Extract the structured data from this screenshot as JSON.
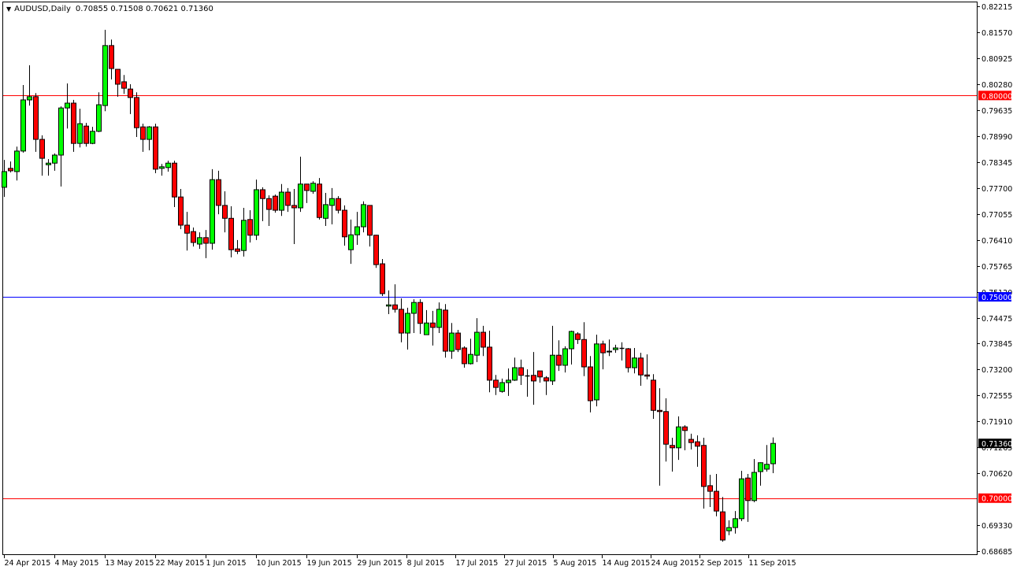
{
  "header": {
    "symbol": "AUDUSD,Daily",
    "ohlc": "0.70855 0.71508 0.70621 0.71360"
  },
  "chart_data": {
    "type": "candlestick",
    "title": "AUDUSD,Daily",
    "ylim": [
      0.68685,
      0.82215
    ],
    "colors": {
      "up": "#00ff00",
      "down": "#ff0000",
      "outline": "#000000"
    },
    "price_ticks": [
      "0.82215",
      "0.81570",
      "0.80925",
      "0.80280",
      "0.79635",
      "0.78990",
      "0.78345",
      "0.77700",
      "0.77055",
      "0.76410",
      "0.75765",
      "0.75120",
      "0.74475",
      "0.73845",
      "0.73200",
      "0.72555",
      "0.71910",
      "0.71265",
      "0.70620",
      "0.69330",
      "0.68685"
    ],
    "date_ticks": [
      "24 Apr 2015",
      "4 May 2015",
      "13 May 2015",
      "22 May 2015",
      "1 Jun 2015",
      "10 Jun 2015",
      "19 Jun 2015",
      "29 Jun 2015",
      "8 Jul 2015",
      "17 Jul 2015",
      "27 Jul 2015",
      "5 Aug 2015",
      "14 Aug 2015",
      "24 Aug 2015",
      "2 Sep 2015",
      "11 Sep 2015"
    ],
    "levels": [
      {
        "price": 0.8,
        "label": "0.80000",
        "color": "#ff0000",
        "line_color": "#ff0000"
      },
      {
        "price": 0.75,
        "label": "0.75000",
        "color": "#0000ff",
        "line_color": "#0000ff"
      },
      {
        "price": 0.7,
        "label": "0.70000",
        "color": "#ff0000",
        "line_color": "#ff0000"
      }
    ],
    "current_price": {
      "price": 0.7136,
      "label": "0.71360",
      "color": "#000000"
    },
    "candles_ohlc": [
      [
        0.7772,
        0.784,
        0.7748,
        0.7811
      ],
      [
        0.7819,
        0.7836,
        0.7809,
        0.7813
      ],
      [
        0.7811,
        0.7873,
        0.7789,
        0.7862
      ],
      [
        0.7862,
        0.8026,
        0.7858,
        0.7989
      ],
      [
        0.7989,
        0.8075,
        0.7975,
        0.7997
      ],
      [
        0.7997,
        0.8006,
        0.786,
        0.7891
      ],
      [
        0.7891,
        0.7901,
        0.7801,
        0.7844
      ],
      [
        0.7828,
        0.7842,
        0.7801,
        0.7832
      ],
      [
        0.7832,
        0.7856,
        0.7813,
        0.7852
      ],
      [
        0.7852,
        0.7973,
        0.7774,
        0.7969
      ],
      [
        0.7969,
        0.803,
        0.7918,
        0.7981
      ],
      [
        0.7981,
        0.7989,
        0.786,
        0.7881
      ],
      [
        0.7881,
        0.7967,
        0.7871,
        0.793
      ],
      [
        0.7924,
        0.7932,
        0.7873,
        0.7881
      ],
      [
        0.7881,
        0.7922,
        0.7879,
        0.7911
      ],
      [
        0.7911,
        0.8008,
        0.7909,
        0.7977
      ],
      [
        0.7975,
        0.8163,
        0.7961,
        0.8124
      ],
      [
        0.8124,
        0.8139,
        0.804,
        0.8067
      ],
      [
        0.8065,
        0.8065,
        0.7997,
        0.8028
      ],
      [
        0.8034,
        0.8051,
        0.8004,
        0.8018
      ],
      [
        0.8016,
        0.8028,
        0.7954,
        0.7995
      ],
      [
        0.7995,
        0.8008,
        0.7897,
        0.792
      ],
      [
        0.7922,
        0.793,
        0.786,
        0.7891
      ],
      [
        0.7891,
        0.7924,
        0.7864,
        0.7922
      ],
      [
        0.7922,
        0.793,
        0.7807,
        0.7817
      ],
      [
        0.7819,
        0.783,
        0.7801,
        0.7823
      ],
      [
        0.7821,
        0.7838,
        0.7811,
        0.7832
      ],
      [
        0.7832,
        0.7838,
        0.7723,
        0.7748
      ],
      [
        0.7748,
        0.7768,
        0.7668,
        0.7678
      ],
      [
        0.7678,
        0.7711,
        0.7615,
        0.7658
      ],
      [
        0.7662,
        0.7672,
        0.7625,
        0.7635
      ],
      [
        0.7631,
        0.766,
        0.7619,
        0.7647
      ],
      [
        0.7647,
        0.7666,
        0.7596,
        0.7633
      ],
      [
        0.7633,
        0.7817,
        0.7617,
        0.7791
      ],
      [
        0.7791,
        0.7813,
        0.7705,
        0.7727
      ],
      [
        0.7727,
        0.7762,
        0.766,
        0.7695
      ],
      [
        0.7695,
        0.7725,
        0.7598,
        0.7617
      ],
      [
        0.7619,
        0.7641,
        0.7606,
        0.7613
      ],
      [
        0.7615,
        0.7721,
        0.76,
        0.769
      ],
      [
        0.7692,
        0.7715,
        0.7635,
        0.7653
      ],
      [
        0.7653,
        0.7791,
        0.7641,
        0.7766
      ],
      [
        0.7766,
        0.7772,
        0.7688,
        0.7744
      ],
      [
        0.7744,
        0.7752,
        0.7676,
        0.7717
      ],
      [
        0.775,
        0.7754,
        0.7709,
        0.7715
      ],
      [
        0.7715,
        0.778,
        0.7701,
        0.776
      ],
      [
        0.776,
        0.777,
        0.7711,
        0.7727
      ],
      [
        0.7727,
        0.7768,
        0.7631,
        0.7721
      ],
      [
        0.7721,
        0.7848,
        0.7711,
        0.778
      ],
      [
        0.778,
        0.778,
        0.7733,
        0.7764
      ],
      [
        0.7762,
        0.7787,
        0.7756,
        0.7782
      ],
      [
        0.778,
        0.7795,
        0.7692,
        0.7697
      ],
      [
        0.7695,
        0.7758,
        0.7676,
        0.7729
      ],
      [
        0.7727,
        0.777,
        0.768,
        0.7744
      ],
      [
        0.7744,
        0.775,
        0.7707,
        0.7715
      ],
      [
        0.7715,
        0.7727,
        0.7627,
        0.7649
      ],
      [
        0.7617,
        0.7692,
        0.7582,
        0.7654
      ],
      [
        0.7654,
        0.7711,
        0.7629,
        0.7674
      ],
      [
        0.7674,
        0.7737,
        0.766,
        0.7729
      ],
      [
        0.7727,
        0.7727,
        0.7625,
        0.7653
      ],
      [
        0.7653,
        0.7654,
        0.7572,
        0.758
      ],
      [
        0.7582,
        0.7594,
        0.7502,
        0.7508
      ],
      [
        0.7477,
        0.7516,
        0.7457,
        0.748
      ],
      [
        0.748,
        0.7531,
        0.7461,
        0.7469
      ],
      [
        0.7469,
        0.7496,
        0.7387,
        0.741
      ],
      [
        0.741,
        0.7473,
        0.7369,
        0.7459
      ],
      [
        0.7459,
        0.7494,
        0.741,
        0.7486
      ],
      [
        0.7486,
        0.7494,
        0.7408,
        0.7434
      ],
      [
        0.7406,
        0.7467,
        0.7406,
        0.7435
      ],
      [
        0.7435,
        0.7465,
        0.7379,
        0.7424
      ],
      [
        0.7424,
        0.7486,
        0.741,
        0.7469
      ],
      [
        0.7467,
        0.7482,
        0.7349,
        0.7365
      ],
      [
        0.7365,
        0.7435,
        0.7346,
        0.741
      ],
      [
        0.741,
        0.7418,
        0.7363,
        0.7369
      ],
      [
        0.7373,
        0.7377,
        0.7324,
        0.7334
      ],
      [
        0.7334,
        0.7396,
        0.7332,
        0.7357
      ],
      [
        0.7355,
        0.7447,
        0.7338,
        0.7412
      ],
      [
        0.7412,
        0.7428,
        0.7353,
        0.7375
      ],
      [
        0.7375,
        0.7416,
        0.7263,
        0.7293
      ],
      [
        0.7293,
        0.7306,
        0.7256,
        0.7275
      ],
      [
        0.7265,
        0.7297,
        0.7262,
        0.7287
      ],
      [
        0.7287,
        0.7322,
        0.7254,
        0.7293
      ],
      [
        0.7293,
        0.7349,
        0.7291,
        0.7324
      ],
      [
        0.7324,
        0.7344,
        0.7281,
        0.7305
      ],
      [
        0.7305,
        0.732,
        0.7252,
        0.7304
      ],
      [
        0.7305,
        0.7363,
        0.7232,
        0.7291
      ],
      [
        0.7316,
        0.7316,
        0.7287,
        0.7301
      ],
      [
        0.7299,
        0.7303,
        0.7256,
        0.7291
      ],
      [
        0.7291,
        0.7428,
        0.7281,
        0.7355
      ],
      [
        0.7355,
        0.7392,
        0.7316,
        0.733
      ],
      [
        0.733,
        0.7377,
        0.7312,
        0.7371
      ],
      [
        0.7371,
        0.7416,
        0.7332,
        0.7414
      ],
      [
        0.7408,
        0.7412,
        0.7383,
        0.7394
      ],
      [
        0.7394,
        0.7437,
        0.7303,
        0.7326
      ],
      [
        0.7326,
        0.7353,
        0.7213,
        0.7242
      ],
      [
        0.7244,
        0.7406,
        0.7228,
        0.7383
      ],
      [
        0.7383,
        0.7391,
        0.732,
        0.7361
      ],
      [
        0.7363,
        0.7394,
        0.7353,
        0.7365
      ],
      [
        0.7369,
        0.7381,
        0.7361,
        0.7373
      ],
      [
        0.7373,
        0.7387,
        0.7342,
        0.7372
      ],
      [
        0.7371,
        0.7373,
        0.7312,
        0.7324
      ],
      [
        0.7324,
        0.7373,
        0.731,
        0.7348
      ],
      [
        0.7348,
        0.7361,
        0.7279,
        0.7306
      ],
      [
        0.7306,
        0.7357,
        0.7295,
        0.7303
      ],
      [
        0.7293,
        0.7308,
        0.7197,
        0.7218
      ],
      [
        0.7218,
        0.7273,
        0.7031,
        0.7215
      ],
      [
        0.7215,
        0.7248,
        0.7091,
        0.7134
      ],
      [
        0.7131,
        0.715,
        0.7066,
        0.7125
      ],
      [
        0.7125,
        0.7203,
        0.7095,
        0.7177
      ],
      [
        0.7177,
        0.7181,
        0.7119,
        0.7168
      ],
      [
        0.7146,
        0.716,
        0.7121,
        0.7138
      ],
      [
        0.714,
        0.7156,
        0.7078,
        0.7129
      ],
      [
        0.7131,
        0.715,
        0.6974,
        0.7029
      ],
      [
        0.7031,
        0.7058,
        0.6978,
        0.7017
      ],
      [
        0.7017,
        0.706,
        0.6955,
        0.6968
      ],
      [
        0.6966,
        0.7003,
        0.6892,
        0.6896
      ],
      [
        0.6919,
        0.6945,
        0.6908,
        0.6927
      ],
      [
        0.6927,
        0.6968,
        0.6912,
        0.6949
      ],
      [
        0.6949,
        0.7068,
        0.6943,
        0.7048
      ],
      [
        0.705,
        0.706,
        0.6941,
        0.6994
      ],
      [
        0.6994,
        0.7097,
        0.699,
        0.7064
      ],
      [
        0.7066,
        0.7089,
        0.7031,
        0.7088
      ],
      [
        0.7072,
        0.7132,
        0.7066,
        0.7084
      ],
      [
        0.70855,
        0.71508,
        0.70621,
        0.7136
      ]
    ]
  }
}
